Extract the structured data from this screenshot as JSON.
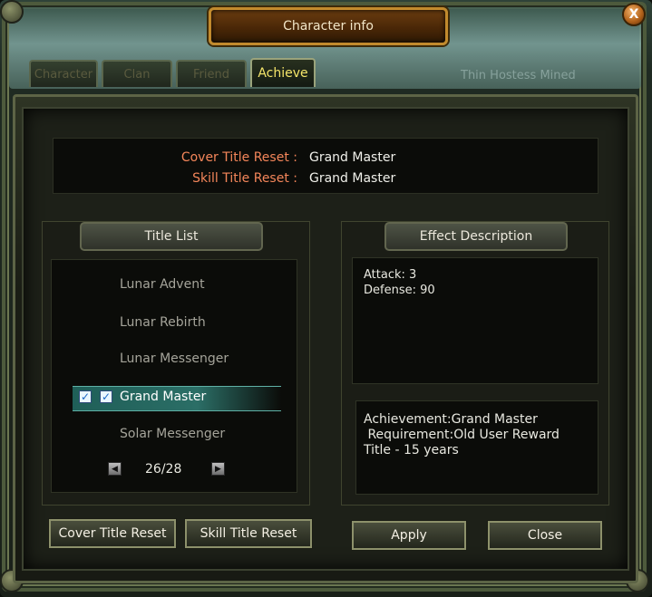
{
  "window": {
    "title": "Character info",
    "close_label": "X"
  },
  "tabs": [
    {
      "label": "Character",
      "active": false
    },
    {
      "label": "Clan",
      "active": false
    },
    {
      "label": "Friend",
      "active": false
    },
    {
      "label": "Achieve",
      "active": true
    }
  ],
  "header_background_text": "Thin Hostess Mined",
  "status": {
    "cover_label": "Cover Title Reset :",
    "cover_value": "Grand Master",
    "skill_label": "Skill Title Reset :",
    "skill_value": "Grand Master"
  },
  "title_list": {
    "header": "Title List",
    "items": [
      {
        "label": "Lunar Advent",
        "selected": false
      },
      {
        "label": "Lunar Rebirth",
        "selected": false
      },
      {
        "label": "Lunar Messenger",
        "selected": false
      },
      {
        "label": "Grand Master",
        "selected": true
      },
      {
        "label": "Solar Messenger",
        "selected": false
      }
    ],
    "pager": "26/28"
  },
  "effect": {
    "header": "Effect Description",
    "line1": "Attack: 3",
    "line2": "Defense: 90",
    "achievement": "Achievement:Grand Master",
    "requirement": " Requirement:Old User Reward",
    "requirement_cont": "Title - 15 years"
  },
  "buttons": {
    "cover_reset": "Cover Title Reset",
    "skill_reset": "Skill Title Reset",
    "apply": "Apply",
    "close": "Close"
  },
  "colors": {
    "accent_label": "#f4865a",
    "active_tab": "#f5e56a",
    "selection": "#2b6e66"
  }
}
